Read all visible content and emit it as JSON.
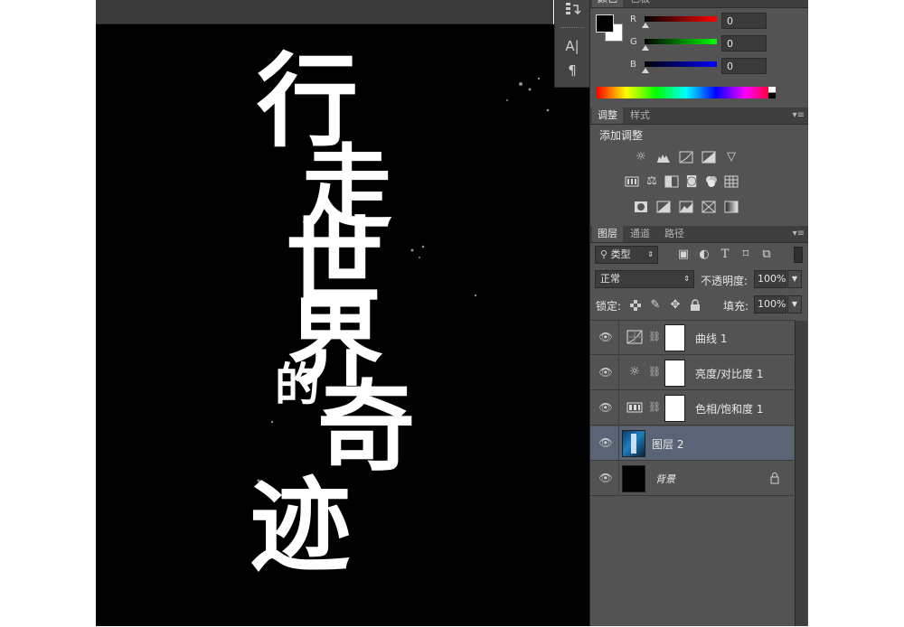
{
  "canvas": {
    "artwork_text": [
      "行",
      "走",
      "世",
      "界",
      "的",
      "奇",
      "迹"
    ]
  },
  "toolstrip": {
    "icons": [
      "history-icon",
      "character-icon",
      "paragraph-icon"
    ],
    "character_glyph": "A|",
    "paragraph_glyph": "¶"
  },
  "color_panel": {
    "tabs": [
      "颜色",
      "色板"
    ],
    "channels": [
      {
        "label": "R",
        "value": "0",
        "color": "#e02020"
      },
      {
        "label": "G",
        "value": "0",
        "color": "#20c020"
      },
      {
        "label": "B",
        "value": "0",
        "color": "#2030e0"
      }
    ],
    "foreground_color": "#000000",
    "background_color": "#ffffff"
  },
  "adjustments_panel": {
    "tabs": [
      "调整",
      "样式"
    ],
    "heading": "添加调整",
    "row1": [
      "brightness-contrast-icon",
      "levels-icon",
      "curves-icon",
      "exposure-icon",
      "vibrance-icon"
    ],
    "row2": [
      "hue-saturation-icon",
      "color-balance-icon",
      "black-white-icon",
      "photo-filter-icon",
      "channel-mixer-icon",
      "color-lookup-icon"
    ],
    "row3": [
      "invert-icon",
      "posterize-icon",
      "threshold-icon",
      "selective-color-icon",
      "gradient-map-icon"
    ]
  },
  "layers_panel": {
    "tabs": [
      "图层",
      "通道",
      "路径"
    ],
    "filter_kind": "类型",
    "blend_mode": "正常",
    "opacity_label": "不透明度:",
    "opacity_value": "100%",
    "lock_label": "锁定:",
    "fill_label": "填充:",
    "fill_value": "100%",
    "layers": [
      {
        "name": "曲线 1",
        "type": "adjustment",
        "icon": "curves-icon",
        "selected": false
      },
      {
        "name": "亮度/对比度 1",
        "type": "adjustment",
        "icon": "brightness-contrast-icon",
        "selected": false
      },
      {
        "name": "色相/饱和度 1",
        "type": "adjustment",
        "icon": "hue-saturation-icon",
        "selected": false
      },
      {
        "name": "图层 2",
        "type": "pixel",
        "icon": "",
        "selected": true
      },
      {
        "name": "背景",
        "type": "background",
        "icon": "lock-icon",
        "selected": false
      }
    ]
  }
}
